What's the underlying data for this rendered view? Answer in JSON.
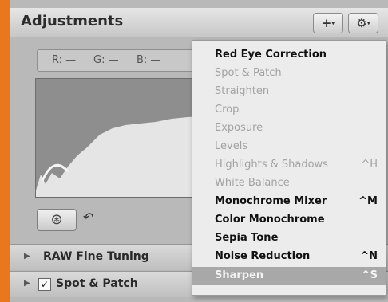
{
  "panel": {
    "title": "Adjustments",
    "add_button": "+",
    "gear_button": "⚙"
  },
  "color_readout": {
    "r": "R: —",
    "g": "G: —",
    "b": "B: —"
  },
  "sections": [
    {
      "label": "RAW Fine Tuning",
      "checked": false
    },
    {
      "label": "Spot & Patch",
      "checked": true
    }
  ],
  "menu": {
    "items": [
      {
        "label": "Red Eye Correction",
        "shortcut": "",
        "state": "enabled"
      },
      {
        "label": "Spot & Patch",
        "shortcut": "",
        "state": "disabled"
      },
      {
        "label": "Straighten",
        "shortcut": "",
        "state": "disabled"
      },
      {
        "label": "Crop",
        "shortcut": "",
        "state": "disabled"
      },
      {
        "label": "Exposure",
        "shortcut": "",
        "state": "disabled"
      },
      {
        "label": "Levels",
        "shortcut": "",
        "state": "disabled"
      },
      {
        "label": "Highlights & Shadows",
        "shortcut": "^H",
        "state": "disabled"
      },
      {
        "label": "White Balance",
        "shortcut": "",
        "state": "disabled"
      },
      {
        "label": "Monochrome Mixer",
        "shortcut": "^M",
        "state": "enabled"
      },
      {
        "label": "Color Monochrome",
        "shortcut": "",
        "state": "enabled"
      },
      {
        "label": "Sepia Tone",
        "shortcut": "",
        "state": "enabled"
      },
      {
        "label": "Noise Reduction",
        "shortcut": "^N",
        "state": "enabled"
      },
      {
        "label": "Sharpen",
        "shortcut": "^S",
        "state": "selected"
      }
    ]
  },
  "colors": {
    "accent": "#e8771d",
    "menu_bg": "#ececec",
    "selected_bg": "#a8a8a8"
  }
}
